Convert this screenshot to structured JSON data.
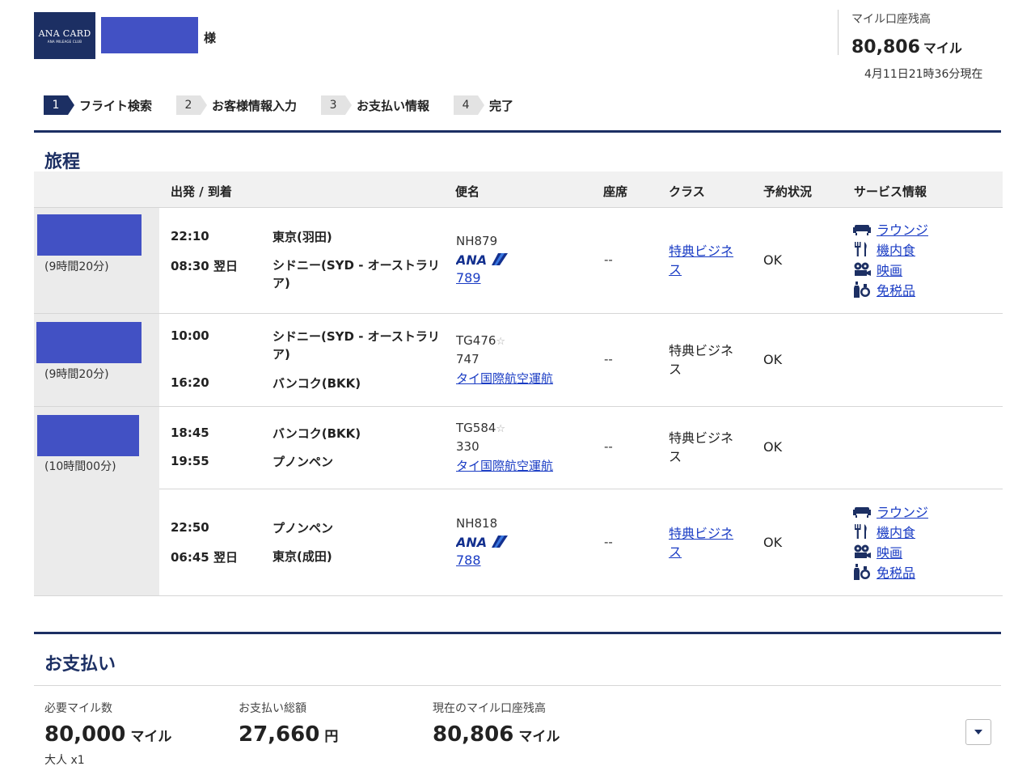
{
  "header": {
    "logo_line1": "ANA CARD",
    "logo_line2": "ANA MILEAGE CLUB",
    "honorific": "様",
    "balance_label": "マイル口座残高",
    "balance_value": "80,806",
    "balance_unit": "マイル",
    "as_of": "4月11日21時36分現在"
  },
  "steps": [
    {
      "num": "1",
      "label": "フライト検索"
    },
    {
      "num": "2",
      "label": "お客様情報入力"
    },
    {
      "num": "3",
      "label": "お支払い情報"
    },
    {
      "num": "4",
      "label": "完了"
    }
  ],
  "itinerary": {
    "title": "旅程",
    "headers": {
      "depart_arrive": "出発 / 到着",
      "flight": "便名",
      "seat": "座席",
      "class": "クラス",
      "status": "予約状況",
      "service": "サービス情報"
    },
    "groups": [
      {
        "duration": "(9時間20分)"
      },
      {
        "duration": "(9時間20分)"
      },
      {
        "duration": "(10時間00分)"
      }
    ],
    "flights": [
      {
        "dep_time": "22:10",
        "dep_place": "東京(羽田)",
        "arr_time": "08:30 翌日",
        "arr_place": "シドニー(SYD - オーストラリア)",
        "flight_no": "NH879",
        "aircraft": "789",
        "seat": "--",
        "class": "特典ビジネス",
        "status": "OK"
      },
      {
        "dep_time": "10:00",
        "dep_place": "シドニー(SYD - オーストラリア)",
        "arr_time": "16:20",
        "arr_place": "バンコク(BKK)",
        "flight_no": "TG476",
        "aircraft": "747",
        "airline": "タイ国際航空運航",
        "seat": "--",
        "class": "特典ビジネス",
        "status": "OK"
      },
      {
        "dep_time": "18:45",
        "dep_place": "バンコク(BKK)",
        "arr_time": "19:55",
        "arr_place": "プノンペン",
        "flight_no": "TG584",
        "aircraft": "330",
        "airline": "タイ国際航空運航",
        "seat": "--",
        "class": "特典ビジネス",
        "status": "OK"
      },
      {
        "dep_time": "22:50",
        "dep_place": "プノンペン",
        "arr_time": "06:45 翌日",
        "arr_place": "東京(成田)",
        "flight_no": "NH818",
        "aircraft": "788",
        "seat": "--",
        "class": "特典ビジネス",
        "status": "OK"
      }
    ],
    "services": {
      "lounge": "ラウンジ",
      "meal": "機内食",
      "movie": "映画",
      "dutyfree": "免税品"
    }
  },
  "payment": {
    "title": "お支払い",
    "required_miles_label": "必要マイル数",
    "required_miles_value": "80,000",
    "miles_unit": "マイル",
    "adult": "大人 x1",
    "total_label": "お支払い総額",
    "total_value": "27,660",
    "yen_unit": "円",
    "current_label": "現在のマイル口座残高",
    "current_value": "80,806"
  },
  "colors": {
    "navy": "#1c2f63",
    "link": "#1a3cc4",
    "redacted_block": "#4251c4"
  }
}
